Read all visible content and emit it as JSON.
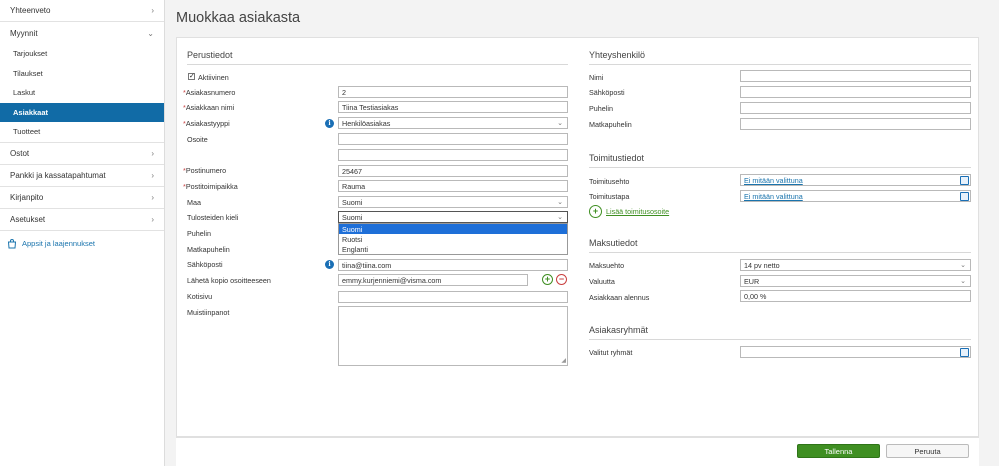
{
  "sidebar": {
    "items": [
      {
        "label": "Yhteenveto",
        "chevron": "right"
      },
      {
        "label": "Myynnit",
        "chevron": "down",
        "children": [
          "Tarjoukset",
          "Tilaukset",
          "Laskut",
          "Asiakkaat",
          "Tuotteet"
        ],
        "active_child": "Asiakkaat"
      },
      {
        "label": "Ostot",
        "chevron": "right"
      },
      {
        "label": "Pankki ja kassatapahtumat",
        "chevron": "right"
      },
      {
        "label": "Kirjanpito",
        "chevron": "right"
      },
      {
        "label": "Asetukset",
        "chevron": "right"
      }
    ],
    "apps_link": "Appsit ja laajennukset"
  },
  "page_title": "Muokkaa asiakasta",
  "basic": {
    "title": "Perustiedot",
    "active_label": "Aktiivinen",
    "active_checked": true,
    "customer_number_label": "Asiakasnumero",
    "customer_number": "2",
    "customer_name_label": "Asiakkaan nimi",
    "customer_name": "Tiina Testiasiakas",
    "customer_type_label": "Asiakastyyppi",
    "customer_type": "Henkilöasiakas",
    "address_label": "Osoite",
    "address_line1": "",
    "address_line2": "",
    "postal_code_label": "Postinumero",
    "postal_code": "25467",
    "city_label": "Postitoimipaikka",
    "city": "Rauma",
    "country_label": "Maa",
    "country": "Suomi",
    "print_lang_label": "Tulosteiden kieli",
    "print_lang": "Suomi",
    "print_lang_options": [
      "Suomi",
      "Ruotsi",
      "Englanti"
    ],
    "print_lang_highlighted": "Suomi",
    "phone_label": "Puhelin",
    "mobile_label": "Matkapuhelin",
    "email_label": "Sähköposti",
    "email": "tiina@tiina.com",
    "copy_email_label": "Lähetä kopio osoitteeseen",
    "copy_email": "emmy.kurjenniemi@visma.com",
    "homepage_label": "Kotisivu",
    "homepage": "",
    "notes_label": "Muistiinpanot",
    "notes": ""
  },
  "contact": {
    "title": "Yhteyshenkilö",
    "name_label": "Nimi",
    "email_label": "Sähköposti",
    "phone_label": "Puhelin",
    "mobile_label": "Matkapuhelin"
  },
  "delivery": {
    "title": "Toimitustiedot",
    "terms_label": "Toimitusehto",
    "terms_value": "Ei mitään valittuna",
    "method_label": "Toimitustapa",
    "method_value": "Ei mitään valittuna",
    "add_address_label": "Lisää toimitusosoite"
  },
  "payment": {
    "title": "Maksutiedot",
    "terms_label": "Maksuehto",
    "terms_value": "14 pv netto",
    "currency_label": "Valuutta",
    "currency_value": "EUR",
    "discount_label": "Asiakkaan alennus",
    "discount_value": "0,00 %"
  },
  "groups": {
    "title": "Asiakasryhmät",
    "selected_label": "Valitut ryhmät",
    "selected_value": ""
  },
  "footer": {
    "save_label": "Tallenna",
    "cancel_label": "Peruuta"
  },
  "colors": {
    "active_nav": "#116ba6",
    "primary_button": "#3f8f22",
    "link": "#1a74ad",
    "required": "#c94040"
  }
}
